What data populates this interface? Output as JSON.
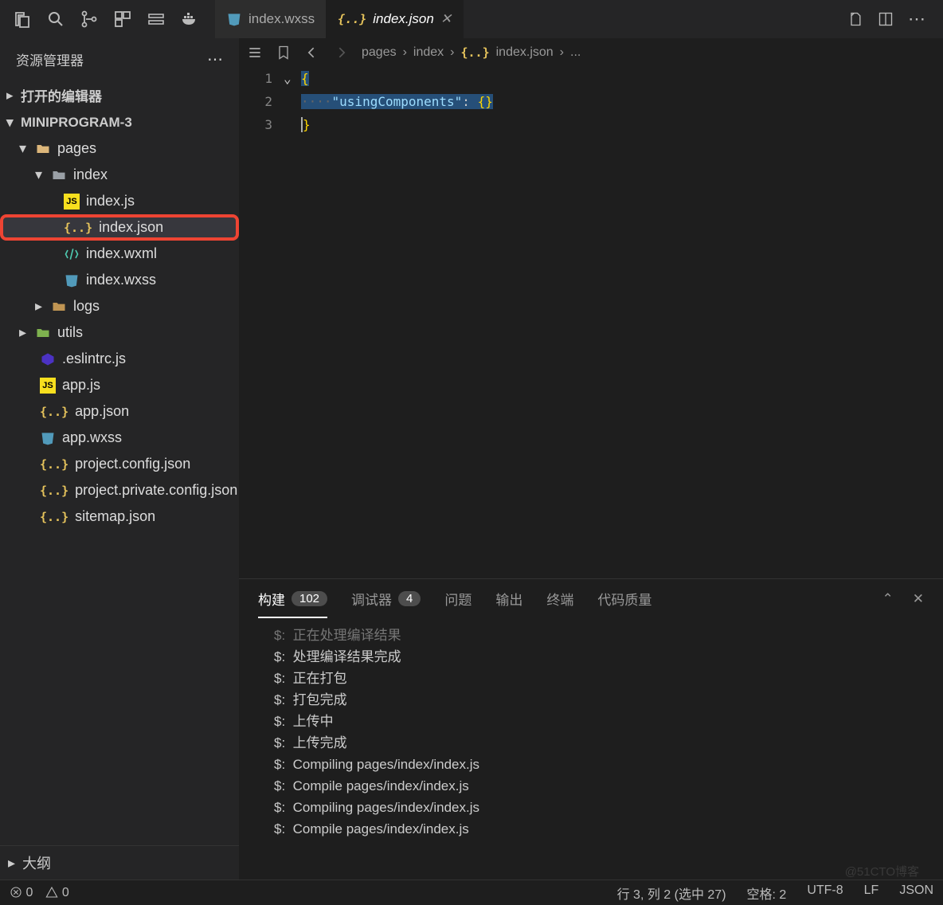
{
  "titlebar": {
    "tabs": [
      {
        "label": "index.wxss",
        "icon": "wxss",
        "active": false
      },
      {
        "label": "index.json",
        "icon": "json",
        "active": true
      }
    ]
  },
  "sidebar": {
    "title": "资源管理器",
    "open_editors": "打开的编辑器",
    "project": "MINIPROGRAM-3",
    "tree": {
      "pages": "pages",
      "pages_index": "index",
      "index_js": "index.js",
      "index_json": "index.json",
      "index_wxml": "index.wxml",
      "index_wxss": "index.wxss",
      "logs": "logs",
      "utils": "utils",
      "eslintrc": ".eslintrc.js",
      "app_js": "app.js",
      "app_json": "app.json",
      "app_wxss": "app.wxss",
      "proj_config": "project.config.json",
      "proj_private": "project.private.config.json",
      "sitemap": "sitemap.json"
    },
    "outline": "大纲"
  },
  "breadcrumb": {
    "p1": "pages",
    "p2": "index",
    "p3": "index.json",
    "p4": "..."
  },
  "editor": {
    "line1": "{",
    "line2_key": "\"usingComponents\"",
    "line2_colon": ":",
    "line2_val": "{}",
    "line3": "}",
    "ws": "····"
  },
  "panel": {
    "tabs": {
      "build": "构建",
      "build_badge": "102",
      "debugger": "调试器",
      "debugger_badge": "4",
      "problems": "问题",
      "output": "输出",
      "terminal": "终端",
      "quality": "代码质量"
    },
    "log": [
      "$:  正在处理编译结果",
      "$:  处理编译结果完成",
      "$:  正在打包",
      "$:  打包完成",
      "$:  上传中",
      "$:  上传完成",
      "$:  Compiling pages/index/index.js",
      "$:  Compile pages/index/index.js",
      "$:  Compiling pages/index/index.js",
      "$:  Compile pages/index/index.js"
    ]
  },
  "status": {
    "errors": "0",
    "warnings": "0",
    "cursor": "行 3, 列 2 (选中 27)",
    "spaces": "空格: 2",
    "encoding": "UTF-8",
    "eol": "LF",
    "lang": "JSON"
  },
  "watermark": "@51CTO博客"
}
